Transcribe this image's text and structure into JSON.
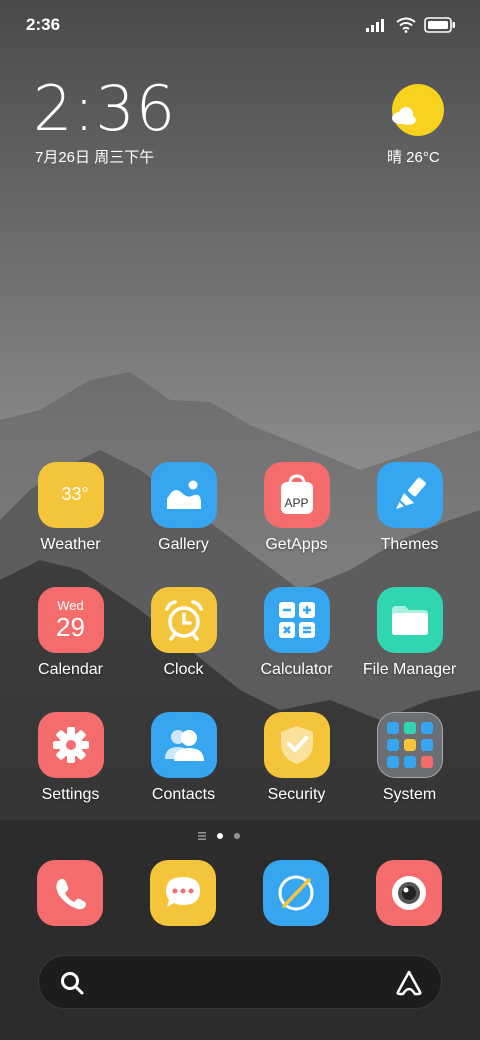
{
  "status": {
    "time": "2:36"
  },
  "clock_widget": {
    "time": "2:36",
    "date": "7月26日 周三下午"
  },
  "weather_widget": {
    "text": "晴 26°C"
  },
  "apps": [
    {
      "label": "Weather",
      "icon": "weather-icon",
      "badge": "33°",
      "color": "#f4c53a"
    },
    {
      "label": "Gallery",
      "icon": "gallery-icon",
      "color": "#35a6ef"
    },
    {
      "label": "GetApps",
      "icon": "getapps-icon",
      "badge": "APP",
      "color": "#f46c6c"
    },
    {
      "label": "Themes",
      "icon": "brush-icon",
      "color": "#35a6ef"
    },
    {
      "label": "Calendar",
      "icon": "calendar-icon",
      "day": "Wed",
      "date": "29",
      "color": "#f46c6c"
    },
    {
      "label": "Clock",
      "icon": "alarm-clock-icon",
      "color": "#f4c53a"
    },
    {
      "label": "Calculator",
      "icon": "calculator-icon",
      "color": "#35a6ef"
    },
    {
      "label": "File Manager",
      "icon": "folder-icon",
      "color": "#2fd6b0"
    },
    {
      "label": "Settings",
      "icon": "gear-icon",
      "color": "#f46c6c"
    },
    {
      "label": "Contacts",
      "icon": "contacts-icon",
      "color": "#35a6ef"
    },
    {
      "label": "Security",
      "icon": "shield-icon",
      "color": "#f4c53a"
    },
    {
      "label": "System",
      "icon": "folder-system-icon",
      "color": "#6b6e73"
    }
  ],
  "dock": [
    {
      "icon": "phone-icon",
      "color": "#f46c6c"
    },
    {
      "icon": "messages-icon",
      "color": "#f4c53a"
    },
    {
      "icon": "browser-icon",
      "color": "#35a6ef"
    },
    {
      "icon": "camera-icon",
      "color": "#f46c6c"
    }
  ],
  "page_indicator": {
    "pages": 2,
    "current": 1
  }
}
